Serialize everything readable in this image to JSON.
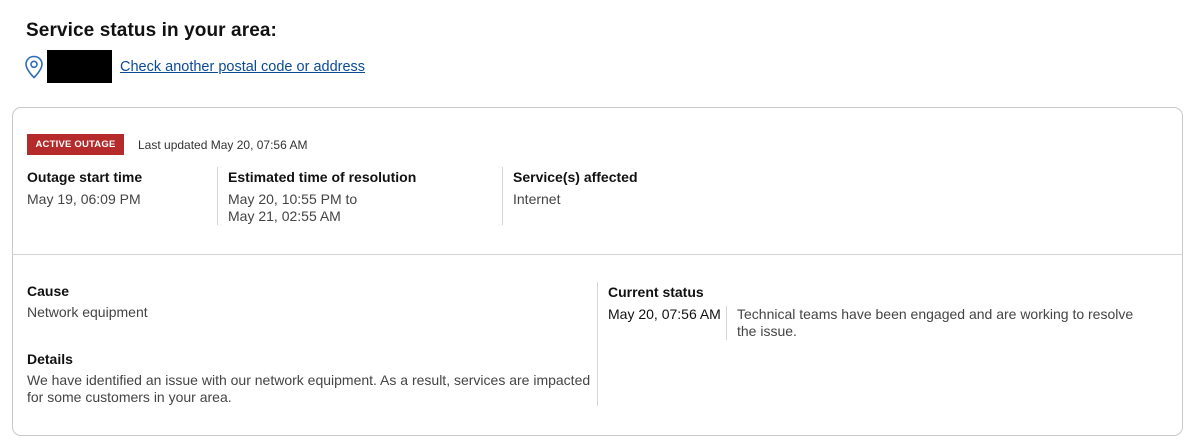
{
  "header": {
    "title": "Service status in your area:",
    "location_icon": "location-pin-icon",
    "check_link": "Check another postal code or address"
  },
  "card": {
    "badge": "ACTIVE OUTAGE",
    "badge_color": "#b52a2a",
    "last_updated": "Last updated May 20, 07:56 AM",
    "outage_start": {
      "label": "Outage start time",
      "value": "May 19, 06:09 PM"
    },
    "resolution": {
      "label": "Estimated time of resolution",
      "value_line1": "May 20, 10:55 PM to",
      "value_line2": "May 21, 02:55 AM"
    },
    "services": {
      "label": "Service(s) affected",
      "value": "Internet"
    },
    "cause": {
      "label": "Cause",
      "value": "Network equipment"
    },
    "details": {
      "label": "Details",
      "value": "We have identified an issue with our network equipment. As a result, services are impacted for some customers in your area."
    },
    "current_status": {
      "label": "Current status",
      "time": "May 20, 07:56 AM",
      "message": "Technical teams have been engaged and are working to resolve the issue."
    }
  },
  "colors": {
    "link": "#0b4b96",
    "border": "#c9c9c9"
  }
}
